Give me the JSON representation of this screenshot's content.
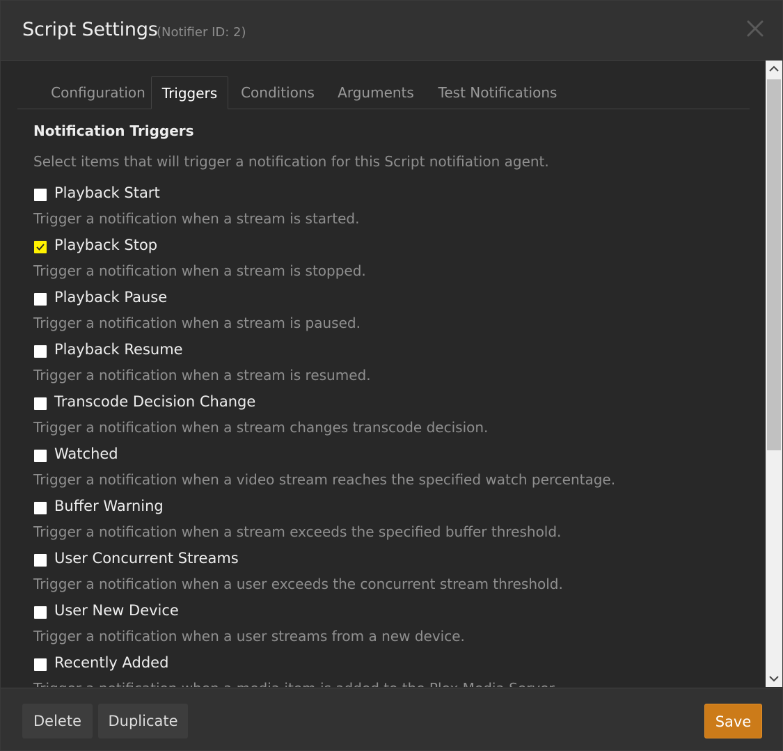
{
  "header": {
    "title": "Script Settings",
    "subtitle": "(Notifier ID: 2)"
  },
  "tabs": [
    {
      "label": "Configuration",
      "active": false
    },
    {
      "label": "Triggers",
      "active": true
    },
    {
      "label": "Conditions",
      "active": false
    },
    {
      "label": "Arguments",
      "active": false
    },
    {
      "label": "Test Notifications",
      "active": false
    }
  ],
  "section": {
    "title": "Notification Triggers",
    "description": "Select items that will trigger a notification for this Script notifiation agent."
  },
  "triggers": [
    {
      "label": "Playback Start",
      "help": "Trigger a notification when a stream is started.",
      "checked": false
    },
    {
      "label": "Playback Stop",
      "help": "Trigger a notification when a stream is stopped.",
      "checked": true
    },
    {
      "label": "Playback Pause",
      "help": "Trigger a notification when a stream is paused.",
      "checked": false
    },
    {
      "label": "Playback Resume",
      "help": "Trigger a notification when a stream is resumed.",
      "checked": false
    },
    {
      "label": "Transcode Decision Change",
      "help": "Trigger a notification when a stream changes transcode decision.",
      "checked": false
    },
    {
      "label": "Watched",
      "help": "Trigger a notification when a video stream reaches the specified watch percentage.",
      "checked": false
    },
    {
      "label": "Buffer Warning",
      "help": "Trigger a notification when a stream exceeds the specified buffer threshold.",
      "checked": false
    },
    {
      "label": "User Concurrent Streams",
      "help": "Trigger a notification when a user exceeds the concurrent stream threshold.",
      "checked": false
    },
    {
      "label": "User New Device",
      "help": "Trigger a notification when a user streams from a new device.",
      "checked": false
    },
    {
      "label": "Recently Added",
      "help": "Trigger a notification when a media item is added to the Plex Media Server.",
      "checked": false
    }
  ],
  "footer": {
    "delete_label": "Delete",
    "duplicate_label": "Duplicate",
    "save_label": "Save"
  },
  "colors": {
    "accent_save": "#cc7b19",
    "checkbox_checked": "#fff200"
  }
}
